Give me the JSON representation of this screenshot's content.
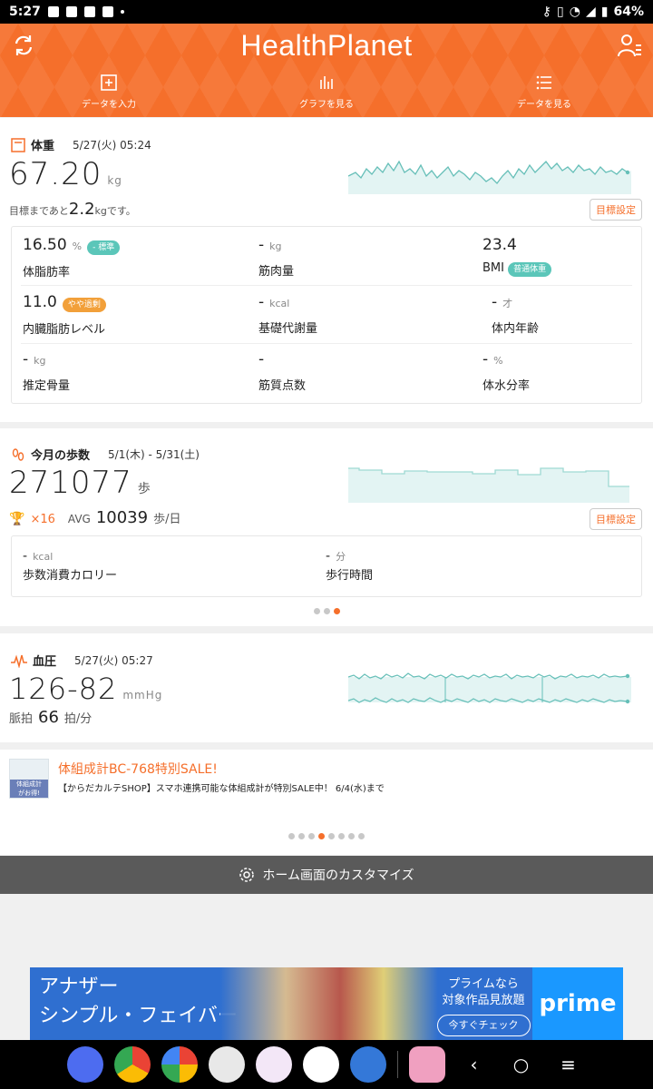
{
  "status_bar": {
    "time": "5:27",
    "battery": "64%"
  },
  "header": {
    "brand": "HealthPlanet",
    "nav": [
      {
        "label": "データを入力"
      },
      {
        "label": "グラフを見る"
      },
      {
        "label": "データを見る"
      }
    ]
  },
  "weight": {
    "title": "体重",
    "date": "5/27(火) 05:24",
    "value": "67.20",
    "unit": "kg",
    "goal_prefix": "目標まであと",
    "goal_value": "2.2",
    "goal_suffix": "kgです。",
    "goal_button": "目標設定",
    "metrics": [
      {
        "value": "16.50",
        "unit": "%",
        "badge": "- 標準",
        "label": "体脂肪率"
      },
      {
        "value": "-",
        "unit": "kg",
        "badge": "",
        "label": "筋肉量"
      },
      {
        "value": "23.4",
        "unit": "",
        "badge": "",
        "label": "BMI",
        "label_badge": "普通体重"
      },
      {
        "value": "11.0",
        "unit": "",
        "badge": "やや過剰",
        "label": "内臓脂肪レベル"
      },
      {
        "value": "-",
        "unit": "kcal",
        "badge": "",
        "label": "基礎代謝量"
      },
      {
        "value": "-",
        "unit": "才",
        "badge": "",
        "label": "体内年齢"
      },
      {
        "value": "-",
        "unit": "kg",
        "badge": "",
        "label": "推定骨量"
      },
      {
        "value": "-",
        "unit": "",
        "badge": "",
        "label": "筋質点数"
      },
      {
        "value": "-",
        "unit": "%",
        "badge": "",
        "label": "体水分率"
      }
    ]
  },
  "steps": {
    "title": "今月の歩数",
    "date": "5/1(木) - 5/31(土)",
    "value": "271077",
    "unit": "歩",
    "trophy_count": "×16",
    "avg_label": "AVG",
    "avg_value": "10039",
    "avg_unit": "歩/日",
    "goal_button": "目標設定",
    "calorie_value": "-",
    "calorie_unit": "kcal",
    "calorie_label": "歩数消費カロリー",
    "time_value": "-",
    "time_unit": "分",
    "time_label": "歩行時間"
  },
  "bp": {
    "title": "血圧",
    "date": "5/27(火) 05:27",
    "value": "126-82",
    "unit": "mmHg",
    "pulse_label": "脈拍",
    "pulse_value": "66",
    "pulse_unit": "拍/分"
  },
  "promo": {
    "img_top": "体組成計",
    "img_bottom": "がお得!",
    "title": "体組成計BC-768特別SALE!",
    "subtitle": "【からだカルテSHOP】スマホ連携可能な体組成計が特別SALE中！ 6/4(水)まで"
  },
  "customize": {
    "label": "ホーム画面のカスタマイズ"
  },
  "ad": {
    "left_line1": "アナザー",
    "left_line2": "シンプル・フェイバー",
    "mid_line1": "プライムなら",
    "mid_line2": "対象作品見放題",
    "button": "今すぐチェック",
    "brand": "prime"
  },
  "colors": {
    "accent": "#f56f2b",
    "teal": "#5bc6b9",
    "badge_orange": "#f2a03a"
  }
}
